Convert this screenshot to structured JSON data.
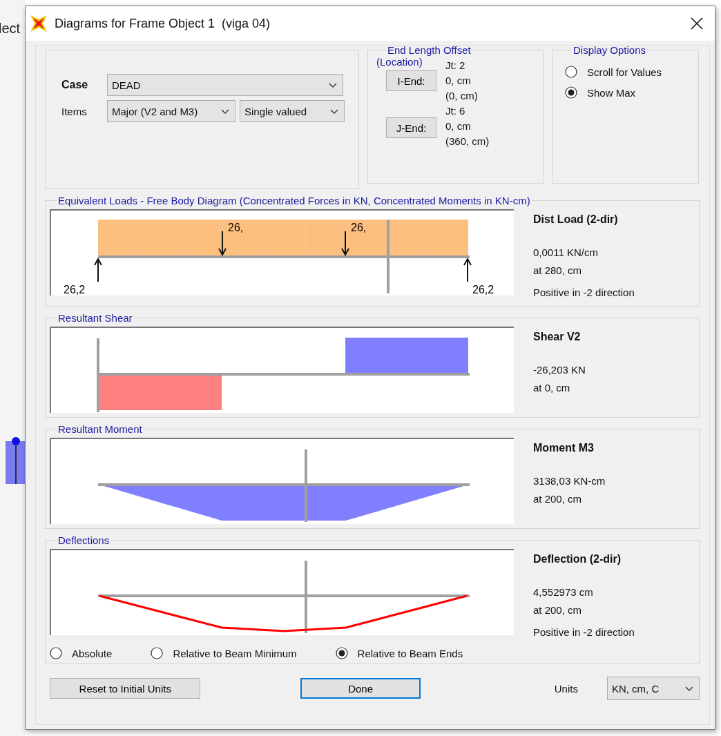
{
  "background": {
    "text": "lect"
  },
  "window": {
    "title": "Diagrams for Frame Object 1  (viga 04)"
  },
  "case": {
    "label": "Case",
    "value": "DEAD"
  },
  "items": {
    "label": "Items",
    "value": "Major (V2 and M3)",
    "mode": "Single valued"
  },
  "end_length_offset": {
    "title": "End Length Offset",
    "subtitle": "(Location)",
    "ends": [
      {
        "button": "I-End:",
        "joint": "Jt:  2",
        "offset": "0, cm",
        "location": "(0, cm)"
      },
      {
        "button": "J-End:",
        "joint": "Jt:  6",
        "offset": "0, cm",
        "location": "(360, cm)"
      }
    ]
  },
  "display_options": {
    "title": "Display Options",
    "options": [
      {
        "label": "Scroll for Values",
        "selected": false
      },
      {
        "label": "Show Max",
        "selected": true
      }
    ]
  },
  "panels": [
    {
      "kind": "loads",
      "title": "Equivalent Loads - Free Body Diagram  (Concentrated Forces in KN, Concentrated Moments in KN-cm)",
      "labels": [
        "26,",
        "26,",
        "26,2",
        "26,2"
      ],
      "heading": "Dist Load (2-dir)",
      "value": "0,0011 KN/cm",
      "location": "at 280, cm",
      "note": "Positive in -2 direction"
    },
    {
      "kind": "shear",
      "title": "Resultant Shear",
      "heading": "Shear V2",
      "value": "-26,203 KN",
      "location": "at 0, cm"
    },
    {
      "kind": "moment",
      "title": "Resultant Moment",
      "heading": "Moment M3",
      "value": "3138,03 KN-cm",
      "location": "at 200, cm"
    },
    {
      "kind": "deflection",
      "title": "Deflections",
      "heading": "Deflection (2-dir)",
      "value": "4,552973 cm",
      "location": "at 200, cm",
      "note": "Positive in -2 direction"
    }
  ],
  "deflection_options": [
    {
      "label": "Absolute",
      "selected": false
    },
    {
      "label": "Relative to Beam Minimum",
      "selected": false
    },
    {
      "label": "Relative to Beam Ends",
      "selected": true
    }
  ],
  "buttons": {
    "reset": "Reset to Initial Units",
    "done": "Done"
  },
  "units": {
    "label": "Units",
    "value": "KN, cm, C"
  }
}
